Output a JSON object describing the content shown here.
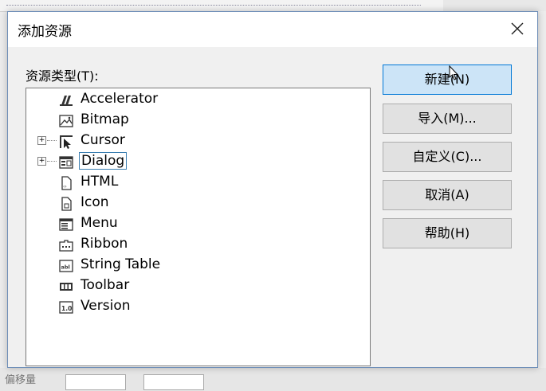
{
  "dialog": {
    "title": "添加资源",
    "close_icon": "close-icon",
    "resource_type_label": "资源类型(T):",
    "tree": {
      "items": [
        {
          "label": "Accelerator",
          "icon": "accelerator-icon",
          "expandable": false
        },
        {
          "label": "Bitmap",
          "icon": "bitmap-icon",
          "expandable": false
        },
        {
          "label": "Cursor",
          "icon": "cursor-icon",
          "expandable": true
        },
        {
          "label": "Dialog",
          "icon": "dialog-icon",
          "expandable": true,
          "selected": true
        },
        {
          "label": "HTML",
          "icon": "html-icon",
          "expandable": false
        },
        {
          "label": "Icon",
          "icon": "icon-resource-icon",
          "expandable": false
        },
        {
          "label": "Menu",
          "icon": "menu-icon",
          "expandable": false
        },
        {
          "label": "Ribbon",
          "icon": "ribbon-icon",
          "expandable": false
        },
        {
          "label": "String Table",
          "icon": "string-table-icon",
          "expandable": false
        },
        {
          "label": "Toolbar",
          "icon": "toolbar-icon",
          "expandable": false
        },
        {
          "label": "Version",
          "icon": "version-icon",
          "expandable": false
        }
      ]
    },
    "buttons": {
      "new": "新建(N)",
      "import": "导入(M)...",
      "custom": "自定义(C)...",
      "cancel": "取消(A)",
      "help": "帮助(H)"
    }
  },
  "background": {
    "bottom_text": "偏移量"
  },
  "colors": {
    "accent": "#0078d7",
    "primary_button_bg": "#cce4f7",
    "button_bg": "#e1e1e1",
    "focus_border": "#3c7fb1"
  }
}
